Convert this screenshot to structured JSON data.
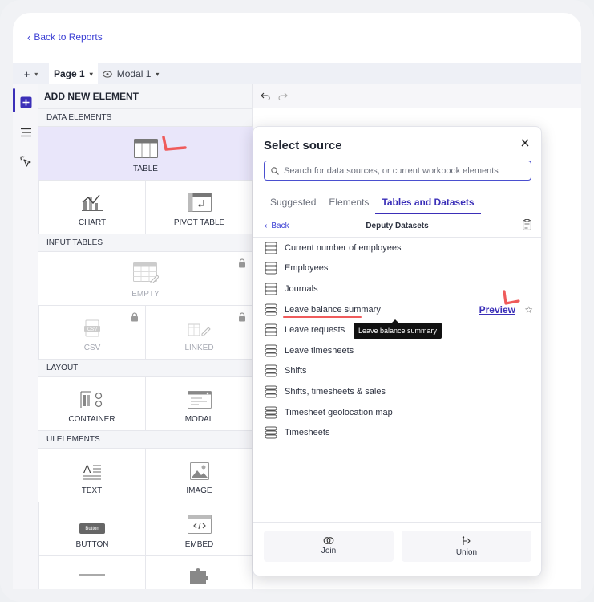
{
  "header": {
    "back_label": "Back to Reports"
  },
  "tabbar": {
    "add_symbol": "+",
    "page_tab": "Page 1",
    "modal_tab": "Modal 1"
  },
  "panel": {
    "title": "ADD NEW ELEMENT",
    "sections": {
      "data_elements": "DATA ELEMENTS",
      "input_tables": "INPUT TABLES",
      "layout": "LAYOUT",
      "ui_elements": "UI ELEMENTS"
    },
    "items": {
      "table": "TABLE",
      "chart": "CHART",
      "pivot_table": "PIVOT TABLE",
      "empty": "EMPTY",
      "csv": "CSV",
      "linked": "LINKED",
      "container": "CONTAINER",
      "modal": "MODAL",
      "text": "TEXT",
      "image": "IMAGE",
      "button": "BUTTON",
      "button_icon_text": "Button",
      "embed": "EMBED"
    }
  },
  "modal": {
    "title": "Select source",
    "search_placeholder": "Search for data sources, or current workbook elements",
    "tabs": [
      "Suggested",
      "Elements",
      "Tables and Datasets"
    ],
    "active_tab": "Tables and Datasets",
    "back_label": "Back",
    "dataset_title": "Deputy Datasets",
    "items": [
      "Current number of employees",
      "Employees",
      "Journals",
      "Leave balance summary",
      "Leave requests",
      "Leave timesheets",
      "Shifts",
      "Shifts, timesheets & sales",
      "Timesheet geolocation map",
      "Timesheets"
    ],
    "preview_label": "Preview",
    "tooltip": "Leave balance summary",
    "footer": {
      "join": "Join",
      "union": "Union"
    }
  },
  "colors": {
    "accent": "#3b2fb8",
    "link": "#3b3fd4",
    "annotation": "#ef5b5b",
    "selected_bg": "#e9e6fa"
  }
}
